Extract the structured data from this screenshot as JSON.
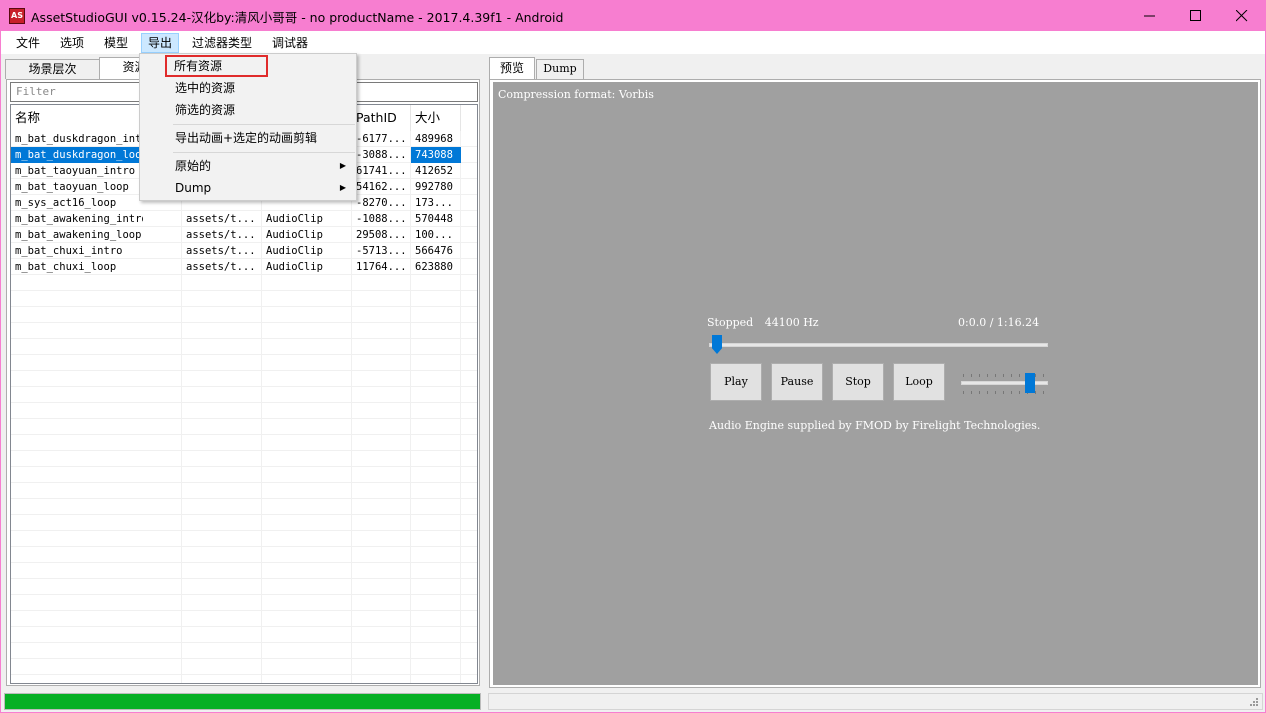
{
  "window": {
    "icon_text": "AS",
    "title": "AssetStudioGUI v0.15.24-汉化by:清风小哥哥 - no productName - 2017.4.39f1 - Android",
    "titlebar_color": "#f77ed0"
  },
  "menu": {
    "items": [
      "文件",
      "选项",
      "模型",
      "导出",
      "过滤器类型",
      "调试器"
    ],
    "active": "导出"
  },
  "export_menu": {
    "items": [
      {
        "label": "所有资源"
      },
      {
        "label": "选中的资源"
      },
      {
        "label": "筛选的资源"
      },
      {
        "label": "导出动画+选定的动画剪辑"
      },
      {
        "label": "原始的",
        "submenu": true
      },
      {
        "label": "Dump",
        "submenu": true
      }
    ]
  },
  "left_tabs": [
    "场景层次",
    "资源列表"
  ],
  "filter": {
    "placeholder": "Filter"
  },
  "asset_list": {
    "headers": [
      "名称",
      "",
      "",
      "PathID",
      "大小"
    ],
    "rows": [
      {
        "name": "m_bat_duskdragon_intro",
        "container": "",
        "type": "",
        "pathid": "-6177...",
        "size": "489968"
      },
      {
        "name": "m_bat_duskdragon_loop",
        "container": "",
        "type": "",
        "pathid": "-3088...",
        "size": "743088",
        "selected": true
      },
      {
        "name": "m_bat_taoyuan_intro",
        "container": "",
        "type": "",
        "pathid": "61741...",
        "size": "412652"
      },
      {
        "name": "m_bat_taoyuan_loop",
        "container": "",
        "type": "",
        "pathid": "54162...",
        "size": "992780"
      },
      {
        "name": "m_sys_act16_loop",
        "container": "",
        "type": "",
        "pathid": "-8270...",
        "size": "173..."
      },
      {
        "name": "m_bat_awakening_intro",
        "container": "assets/t...",
        "type": "AudioClip",
        "pathid": "-1088...",
        "size": "570448"
      },
      {
        "name": "m_bat_awakening_loop",
        "container": "assets/t...",
        "type": "AudioClip",
        "pathid": "29508...",
        "size": "100..."
      },
      {
        "name": "m_bat_chuxi_intro",
        "container": "assets/t...",
        "type": "AudioClip",
        "pathid": "-5713...",
        "size": "566476"
      },
      {
        "name": "m_bat_chuxi_loop",
        "container": "assets/t...",
        "type": "AudioClip",
        "pathid": "11764...",
        "size": "623880"
      }
    ]
  },
  "progress": {
    "value": 1.0,
    "color": "#06b025"
  },
  "right_tabs": [
    "预览",
    "Dump"
  ],
  "preview": {
    "compression": "Compression format: Vorbis",
    "status": "Stopped",
    "frequency": "44100 Hz",
    "time": "0:0.0 / 1:16.24",
    "seek_position": 0.0,
    "volume_level": 0.8,
    "buttons": [
      "Play",
      "Pause",
      "Stop",
      "Loop"
    ],
    "engine_note": "Audio Engine supplied by FMOD by Firelight Technologies."
  }
}
